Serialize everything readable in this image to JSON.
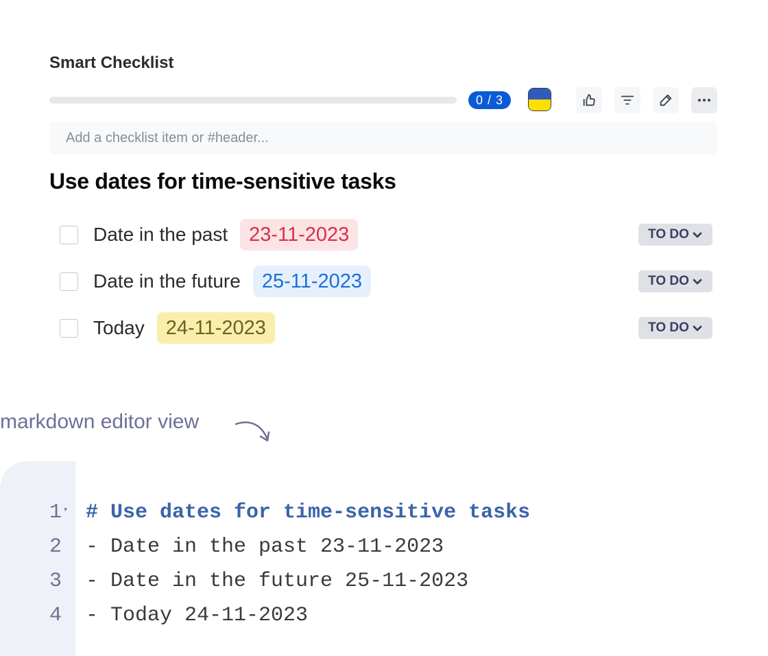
{
  "checklist": {
    "title": "Smart Checklist",
    "progress": {
      "done": 0,
      "total": 3,
      "label": "0 / 3",
      "fraction": 0
    },
    "flag_colors": {
      "top": "#2f5bbf",
      "bottom": "#ffdf00"
    },
    "toolbar": {
      "like_icon": "thumbs-up-icon",
      "filter_icon": "filter-icon",
      "edit_icon": "pencil-icon",
      "more_icon": "more-horizontal-icon"
    },
    "add_input": {
      "placeholder": "Add a checklist item or #header...",
      "value": ""
    },
    "header": "Use dates for time-sensitive tasks",
    "items": [
      {
        "text": "Date in the past",
        "date": "23-11-2023",
        "date_kind": "past",
        "date_color": "#d6304a",
        "date_bg": "#fbe3e6",
        "checked": false,
        "status": "TO DO"
      },
      {
        "text": "Date in the future",
        "date": "25-11-2023",
        "date_kind": "future",
        "date_color": "#1b6fd8",
        "date_bg": "#e6f0fd",
        "checked": false,
        "status": "TO DO"
      },
      {
        "text": "Today",
        "date": "24-11-2023",
        "date_kind": "today",
        "date_color": "#6b5f2a",
        "date_bg": "#fbeeaa",
        "checked": false,
        "status": "TO DO"
      }
    ]
  },
  "annotation": {
    "label": "markdown editor view",
    "icon": "curved-arrow-icon"
  },
  "editor": {
    "lines": [
      {
        "number": "1",
        "text": "# Use dates for time-sensitive tasks",
        "kind": "heading",
        "foldable": true
      },
      {
        "number": "2",
        "text": "- Date in the past 23-11-2023",
        "kind": "list"
      },
      {
        "number": "3",
        "text": "- Date in the future 25-11-2023",
        "kind": "list"
      },
      {
        "number": "4",
        "text": "- Today 24-11-2023",
        "kind": "list"
      }
    ]
  }
}
